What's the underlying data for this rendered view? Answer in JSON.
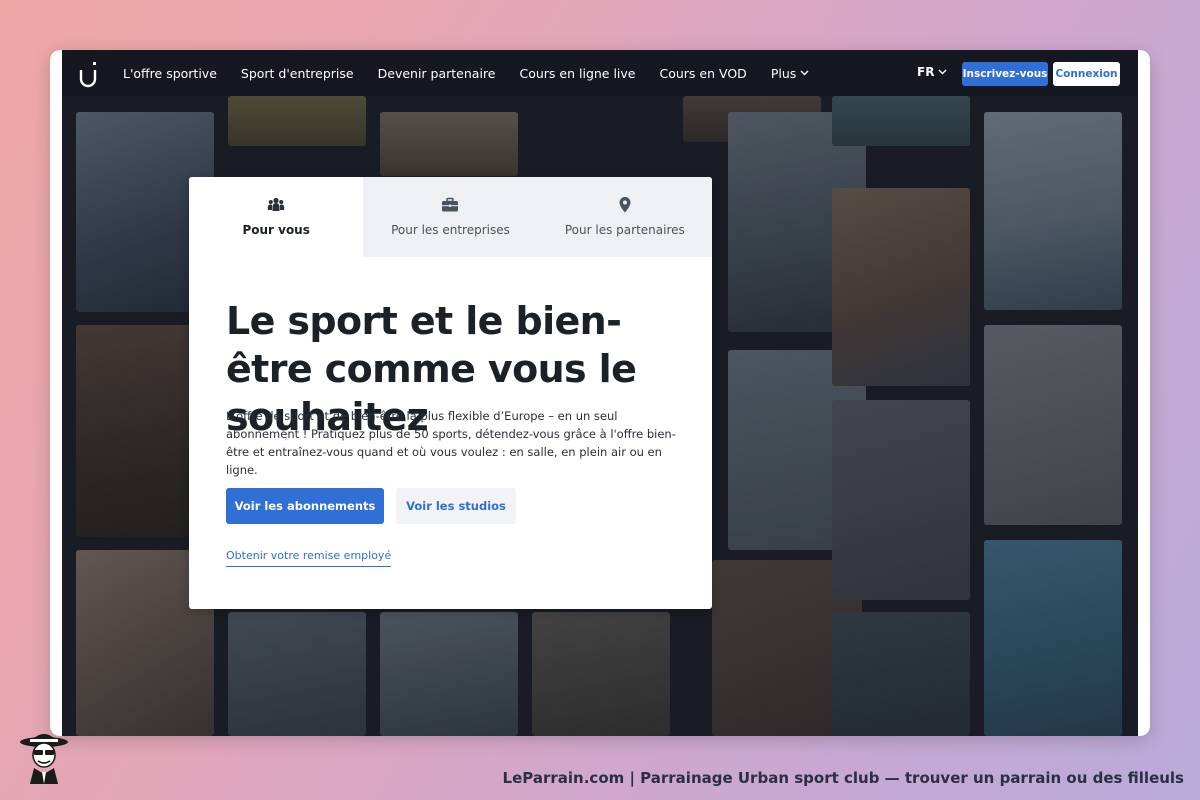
{
  "nav": {
    "links": [
      {
        "label": "L'offre sportive"
      },
      {
        "label": "Sport d'entreprise"
      },
      {
        "label": "Devenir partenaire"
      },
      {
        "label": "Cours en ligne live"
      },
      {
        "label": "Cours en VOD"
      },
      {
        "label": "Plus"
      }
    ],
    "lang": "FR",
    "signup_label": "Inscrivez-vous",
    "login_label": "Connexion",
    "icons": {
      "logo": "urban-sports-logo-icon",
      "dropdown": "chevron-down-icon"
    }
  },
  "card": {
    "tabs": [
      {
        "label": "Pour vous",
        "icon": "people-icon",
        "active": true
      },
      {
        "label": "Pour les entreprises",
        "icon": "briefcase-icon",
        "active": false
      },
      {
        "label": "Pour les partenaires",
        "icon": "location-pin-icon",
        "active": false
      }
    ],
    "headline": "Le sport et le bien-être comme vous le souhaitez",
    "description": "L’offre de sport et de bien-être la plus flexible d’Europe – en un seul abonnement ! Pratiquez plus de 50 sports, détendez-vous grâce à l'offre bien-être et entraînez-vous quand et où vous voulez : en salle, en plein air ou en ligne.",
    "primary_button": "Voir les abonnements",
    "secondary_button": "Voir les studios",
    "discount_link": "Obtenir votre remise employé"
  },
  "footer": {
    "caption": "LeParrain.com | Parrainage Urban sport club — trouver un parrain ou des filleuls",
    "mascot_icon": "mascot-icon"
  },
  "colors": {
    "accent": "#2f6fd6",
    "dark_bg": "#1c2027",
    "text_dark": "#1c2027"
  }
}
